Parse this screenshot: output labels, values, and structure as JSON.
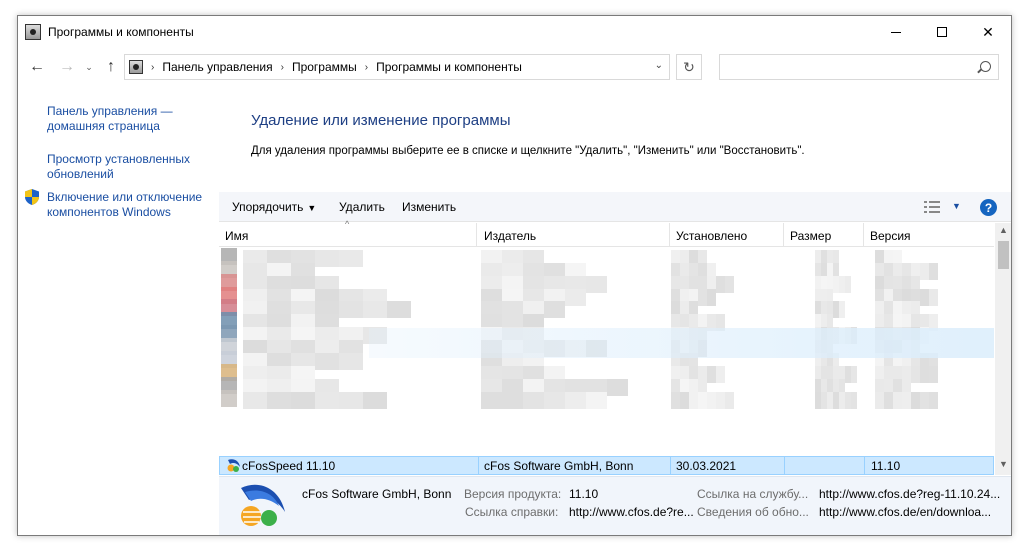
{
  "window": {
    "title": "Программы и компоненты",
    "minimize_glyph": "",
    "close_glyph": "✕"
  },
  "nav": {
    "back_glyph": "←",
    "forward_glyph": "→",
    "recent_glyph": "⌄",
    "up_glyph": "↑",
    "breadcrumbs": [
      "Панель управления",
      "Программы",
      "Программы и компоненты"
    ],
    "separator": "›",
    "dropdown_glyph": "⌄",
    "refresh_glyph": "↻",
    "search_placeholder": "",
    "search_value": ""
  },
  "sidebar": {
    "links": [
      {
        "label": "Панель управления — домашняя страница"
      },
      {
        "label": "Просмотр установленных обновлений"
      },
      {
        "label": "Включение или отключение компонентов Windows",
        "icon": "uac-shield-icon"
      }
    ]
  },
  "main": {
    "title": "Удаление или изменение программы",
    "description": "Для удаления программы выберите ее в списке и щелкните \"Удалить\", \"Изменить\" или \"Восстановить\"."
  },
  "toolbar": {
    "organize": "Упорядочить",
    "organize_dd": "▼",
    "uninstall": "Удалить",
    "change": "Изменить",
    "view_dd": "▼",
    "help": "?"
  },
  "table": {
    "columns": [
      "Имя",
      "Издатель",
      "Установлено",
      "Размер",
      "Версия"
    ],
    "sort_glyph": "^",
    "selected_row": {
      "name": "cFosSpeed 11.10",
      "publisher": "cFos Software GmbH, Bonn",
      "installed": "30.03.2021",
      "size": "",
      "version": "11.10"
    },
    "blurred_rows": 9
  },
  "scrollbar": {
    "up_glyph": "▲",
    "down_glyph": "▼"
  },
  "details": {
    "publisher": "cFos Software GmbH, Bonn",
    "product_version_label": "Версия продукта:",
    "product_version": "11.10",
    "help_link_label": "Ссылка справки:",
    "help_link": "http://www.cfos.de?re...",
    "support_link_label": "Ссылка на службу...",
    "support_link": "http://www.cfos.de?reg-11.10.24...",
    "update_info_label": "Сведения об обно...",
    "update_info": "http://www.cfos.de/en/downloa..."
  },
  "colors": {
    "link": "#1a4ea2",
    "title": "#1e3f84",
    "selection": "#cce8ff",
    "details_bg": "#f1f5fb"
  }
}
